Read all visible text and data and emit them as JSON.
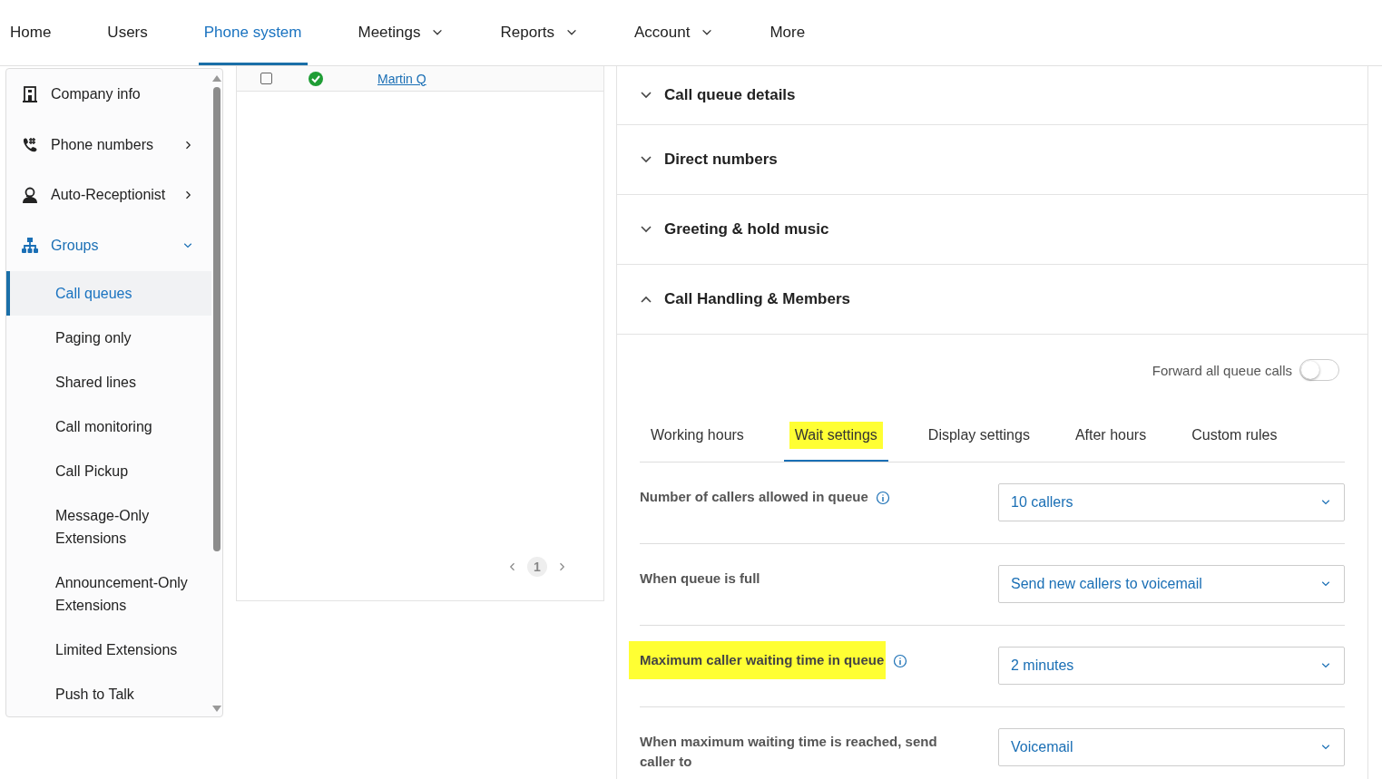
{
  "nav": [
    {
      "label": "Home",
      "selected": false,
      "has_menu": false
    },
    {
      "label": "Users",
      "selected": false,
      "has_menu": false
    },
    {
      "label": "Phone system",
      "selected": true,
      "has_menu": false
    },
    {
      "label": "Meetings",
      "selected": false,
      "has_menu": true
    },
    {
      "label": "Reports",
      "selected": false,
      "has_menu": true
    },
    {
      "label": "Account",
      "selected": false,
      "has_menu": true
    },
    {
      "label": "More",
      "selected": false,
      "has_menu": false
    }
  ],
  "sidebar": {
    "items": [
      {
        "label": "Company info"
      },
      {
        "label": "Phone numbers",
        "expanded": false
      },
      {
        "label": "Auto-Receptionist",
        "expanded": false
      },
      {
        "label": "Groups",
        "expanded": true,
        "children": [
          {
            "label": "Call queues",
            "selected": true
          },
          {
            "label": "Paging only",
            "selected": false
          },
          {
            "label": "Shared lines",
            "selected": false
          },
          {
            "label": "Call monitoring",
            "selected": false
          },
          {
            "label": "Call Pickup",
            "selected": false
          },
          {
            "label": "Message-Only Extensions",
            "selected": false
          },
          {
            "label": "Announcement-Only Extensions",
            "selected": false
          },
          {
            "label": "Limited Extensions",
            "selected": false
          },
          {
            "label": "Push to Talk",
            "selected": false
          }
        ]
      }
    ]
  },
  "list": {
    "row": {
      "checked": false,
      "link": "Martin Q"
    },
    "pagination": {
      "page": "1"
    }
  },
  "details": {
    "sections": [
      {
        "title": "Call queue details",
        "expanded": false
      },
      {
        "title": "Direct numbers",
        "expanded": false
      },
      {
        "title": "Greeting & hold music",
        "expanded": false
      },
      {
        "title": "Call Handling & Members",
        "expanded": true
      }
    ],
    "forward": {
      "label": "Forward all queue calls",
      "on": false
    },
    "tabs": [
      {
        "label": "Working hours",
        "selected": false,
        "highlighted": false
      },
      {
        "label": "Wait settings",
        "selected": true,
        "highlighted": true
      },
      {
        "label": "Display settings",
        "selected": false,
        "highlighted": false
      },
      {
        "label": "After hours",
        "selected": false,
        "highlighted": false
      },
      {
        "label": "Custom rules",
        "selected": false,
        "highlighted": false
      }
    ],
    "settings": [
      {
        "label": "Number of callers allowed in queue",
        "info": true,
        "highlighted": false,
        "value": "10 callers"
      },
      {
        "label": "When queue is full",
        "info": false,
        "highlighted": false,
        "value": "Send new callers to voicemail"
      },
      {
        "label": "Maximum caller waiting time in queue",
        "info": true,
        "highlighted": true,
        "value": "2 minutes"
      },
      {
        "label": "When maximum waiting time is reached, send caller to",
        "info": false,
        "highlighted": false,
        "value": "Voicemail"
      }
    ]
  }
}
